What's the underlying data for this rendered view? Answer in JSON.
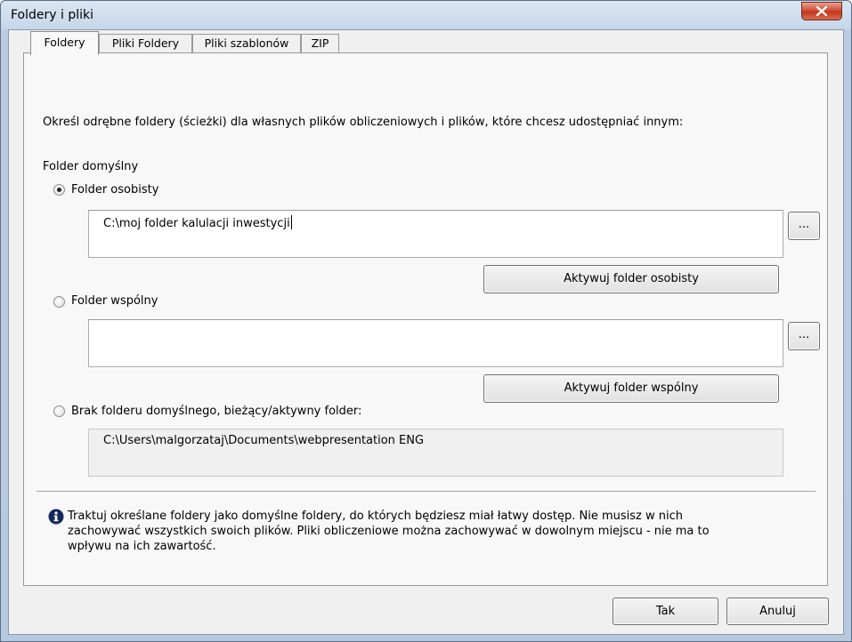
{
  "window": {
    "title": "Foldery i pliki",
    "close_symbol": "✕"
  },
  "tabs": [
    {
      "label": "Foldery",
      "active": true
    },
    {
      "label": "Pliki Foldery",
      "active": false
    },
    {
      "label": "Pliki szablonów",
      "active": false
    },
    {
      "label": "ZIP",
      "active": false
    }
  ],
  "folders": {
    "intro": "Określ odrębne foldery (ścieżki) dla własnych plików obliczeniowych i plików, które chcesz udostępniać innym:",
    "default_label": "Folder domyślny",
    "personal": {
      "label": "Folder osobisty",
      "selected": true,
      "path": "C:\\moj folder kalulacji inwestycji",
      "browse_label": "...",
      "activate_label": "Aktywuj folder osobisty"
    },
    "shared": {
      "label": "Folder wspólny",
      "selected": false,
      "path": "",
      "browse_label": "...",
      "activate_label": "Aktywuj folder wspólny"
    },
    "none": {
      "label": "Brak folderu domyślnego, bieżący/aktywny folder:",
      "selected": false,
      "path": "C:\\Users\\malgorzataj\\Documents\\webpresentation ENG"
    },
    "info": {
      "icon": "info-icon",
      "line1": "Traktuj określane foldery jako domyślne foldery, do których będziesz miał łatwy dostęp. Nie musisz w nich",
      "line2": "zachowywać wszystkich swoich plików. Pliki obliczeniowe można zachowywać w dowolnym miejscu - nie ma to",
      "line3": "wpływu na ich zawartość."
    }
  },
  "buttons": {
    "ok": "Tak",
    "cancel": "Anuluj"
  }
}
